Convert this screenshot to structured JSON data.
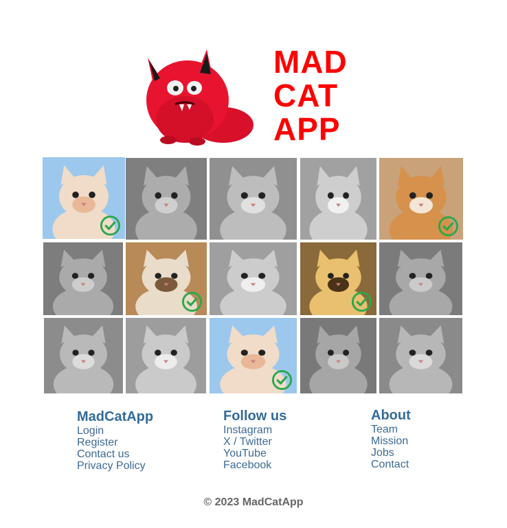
{
  "brand": {
    "lines": [
      "MAD",
      "CAT",
      "APP"
    ],
    "color": "#ff0000"
  },
  "gallery": {
    "tiles": [
      {
        "label": "Kitten photo 1",
        "selected": true,
        "color": true
      },
      {
        "label": "Kitten photo 2",
        "selected": false,
        "color": false
      },
      {
        "label": "Kitten photo 3",
        "selected": false,
        "color": false
      },
      {
        "label": "Kitten photo 4",
        "selected": false,
        "color": false
      },
      {
        "label": "Kitten photo 5",
        "selected": true,
        "color": true
      },
      {
        "label": "Kitten photo 6",
        "selected": false,
        "color": false
      },
      {
        "label": "Kitten photo 7",
        "selected": true,
        "color": true
      },
      {
        "label": "Kitten photo 8",
        "selected": false,
        "color": false
      },
      {
        "label": "Kitten photo 9",
        "selected": true,
        "color": true
      },
      {
        "label": "Kitten photo 10",
        "selected": false,
        "color": false
      },
      {
        "label": "Kitten photo 11",
        "selected": false,
        "color": false
      },
      {
        "label": "Kitten photo 12",
        "selected": false,
        "color": false
      },
      {
        "label": "Kitten photo 13",
        "selected": true,
        "color": true
      },
      {
        "label": "Kitten photo 14",
        "selected": false,
        "color": false
      },
      {
        "label": "Kitten photo 15",
        "selected": false,
        "color": false
      }
    ],
    "check_icon": "check-circle-icon",
    "check_color": "#2aa84a"
  },
  "footer": {
    "columns": [
      {
        "title": "MadCatApp",
        "links": [
          "Login",
          "Register",
          "Contact us",
          "Privacy Policy"
        ]
      },
      {
        "title": "Follow us",
        "links": [
          "Instagram",
          "X / Twitter",
          "YouTube",
          "Facebook"
        ]
      },
      {
        "title": "About",
        "links": [
          "Team",
          "Mission",
          "Jobs",
          "Contact"
        ]
      }
    ],
    "title_color": "#336b99",
    "link_color": "#3c6a95"
  },
  "copyright": "© 2023 MadCatApp"
}
